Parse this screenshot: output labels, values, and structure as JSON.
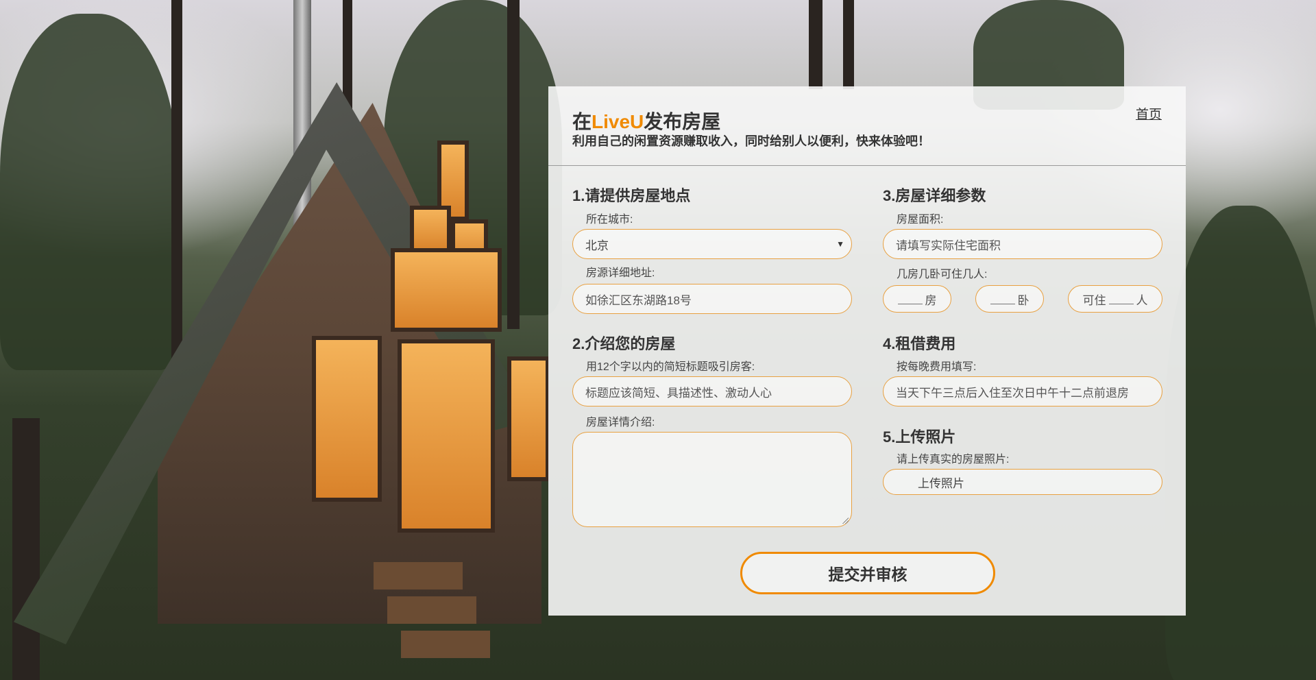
{
  "header": {
    "title_prefix": "在",
    "brand": "LiveU",
    "title_suffix": "发布房屋",
    "subtitle": "利用自己的闲置资源赚取收入，同时给别人以便利，快来体验吧！",
    "home_link": "首页"
  },
  "location": {
    "section_title": "1.请提供房屋地点",
    "city_label": "所在城市:",
    "city_value": "北京",
    "address_label": "房源详细地址:",
    "address_placeholder": "如徐汇区东湖路18号"
  },
  "intro": {
    "section_title": "2.介绍您的房屋",
    "title_label": "用12个字以内的简短标题吸引房客:",
    "title_placeholder": "标题应该简短、具描述性、激动人心",
    "detail_label": "房屋详情介绍:"
  },
  "params": {
    "section_title": "3.房屋详细参数",
    "area_label": "房屋面积:",
    "area_placeholder": "请填写实际住宅面积",
    "rooms_label": "几房几卧可住几人:",
    "rooms_suffix": "房",
    "bedrooms_suffix": "卧",
    "guests_prefix": "可住",
    "guests_suffix": "人"
  },
  "fee": {
    "section_title": "4.租借费用",
    "fee_label": "按每晚费用填写:",
    "fee_placeholder": "当天下午三点后入住至次日中午十二点前退房"
  },
  "photos": {
    "section_title": "5.上传照片",
    "photos_label": "请上传真实的房屋照片:",
    "upload_label": "上传照片"
  },
  "submit_label": "提交并审核",
  "colors": {
    "accent": "#f08a00",
    "field_border": "#e8a040",
    "panel_bg": "#f7f7f7"
  }
}
